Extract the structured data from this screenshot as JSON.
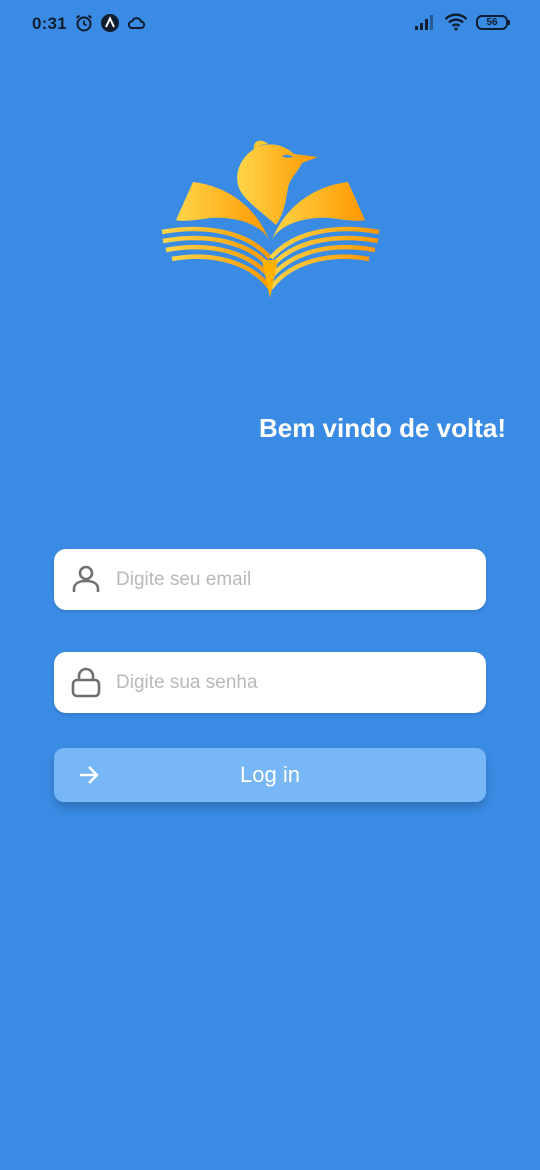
{
  "status_bar": {
    "time": "0:31",
    "battery_level": "56",
    "left_icons": [
      "alarm-icon",
      "app-notification-icon",
      "cloud-icon"
    ],
    "right_icons": [
      "signal-icon",
      "wifi-icon",
      "battery-icon"
    ]
  },
  "colors": {
    "background": "#3a8be4",
    "logo_primary": "#ffc933",
    "logo_secondary": "#ff9a00",
    "button": "#78b7f6",
    "placeholder": "#b9b9b9"
  },
  "welcome_text": "Bem vindo de volta!",
  "form": {
    "email_placeholder": "Digite seu email",
    "email_value": "",
    "password_placeholder": "Digite sua senha",
    "password_value": "",
    "login_label": "Log in"
  }
}
